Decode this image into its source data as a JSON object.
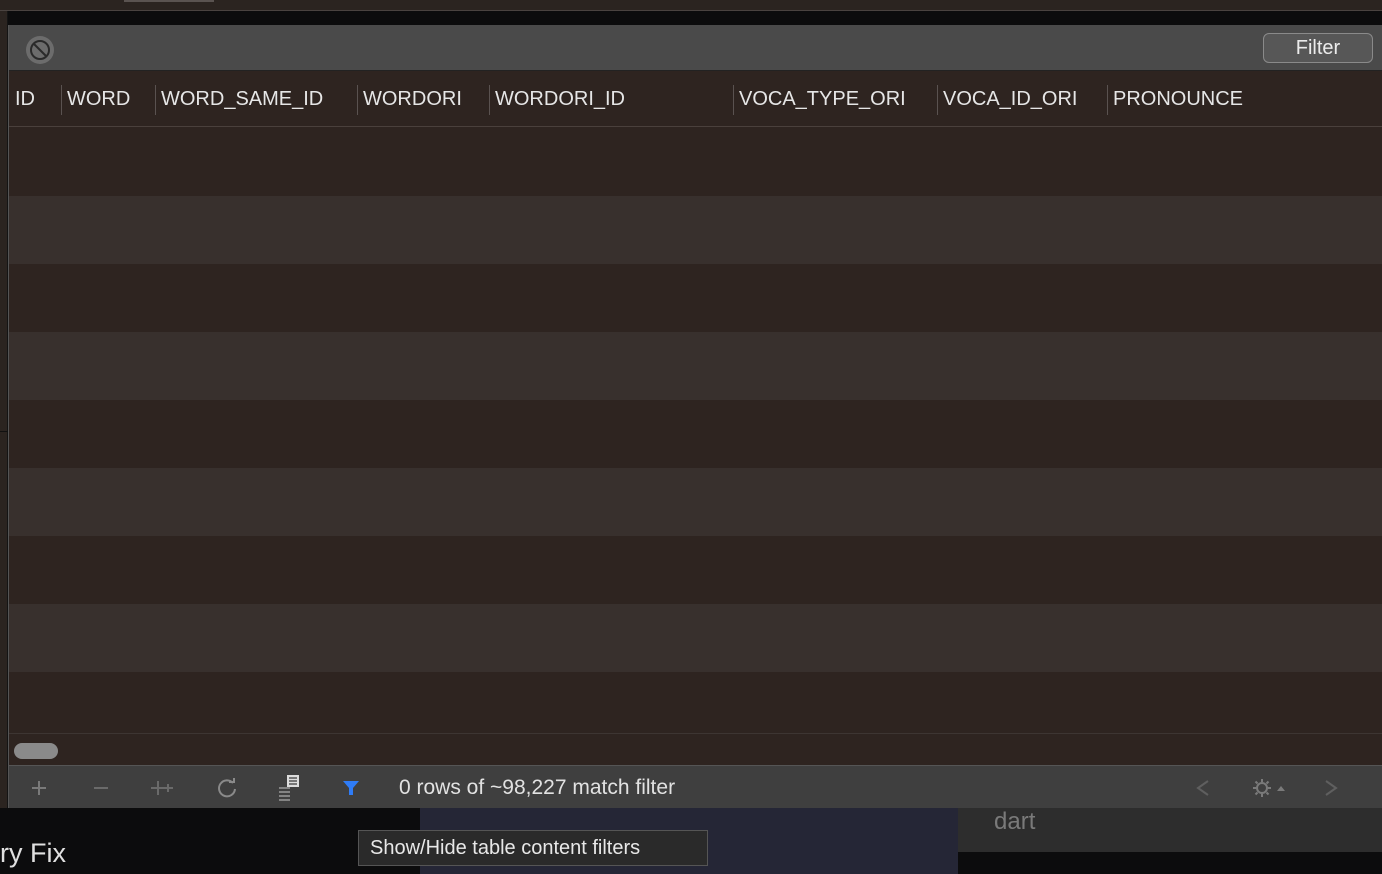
{
  "filter_bar": {
    "filter_button_label": "Filter"
  },
  "table": {
    "columns": [
      "ID",
      "WORD",
      "WORD_SAME_ID",
      "WORDORI",
      "WORDORI_ID",
      "VOCA_TYPE_ORI",
      "VOCA_ID_ORI",
      "PRONOUNCE"
    ],
    "rows": []
  },
  "status_bar": {
    "status_text": "0 rows of ~98,227 match filter"
  },
  "tooltip": {
    "text": "Show/Hide table content filters"
  },
  "background": {
    "left_text": "ry Fix",
    "right_text": "dart"
  },
  "icons": {
    "clear_filter": "clear-filter-icon",
    "add_row": "add-icon",
    "delete_row": "remove-icon",
    "duplicate_row": "duplicate-icon",
    "refresh": "refresh-icon",
    "export": "export-icon",
    "filter_toggle": "funnel-icon",
    "prev_page": "chevron-left-icon",
    "settings": "gear-icon",
    "next_page": "chevron-right-icon"
  },
  "colors": {
    "accent": "#2f7cf6",
    "row_odd": "#2e2420",
    "row_even": "#38302d"
  }
}
